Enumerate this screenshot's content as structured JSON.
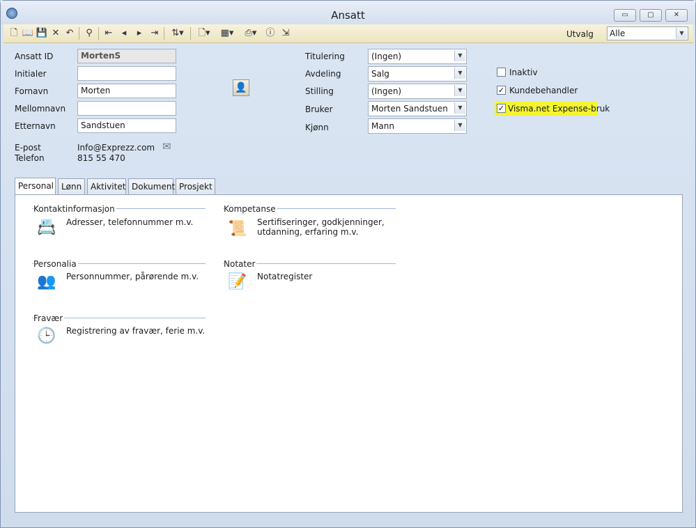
{
  "window": {
    "title": "Ansatt",
    "minimize_glyph": "▭",
    "maximize_glyph": "▢",
    "close_glyph": "✕"
  },
  "toolbar": {
    "icons": [
      "new-icon",
      "open-book-icon",
      "save-icon",
      "delete-icon",
      "undo-icon",
      "search-icon",
      "first-record-icon",
      "prev-record-icon",
      "next-record-icon",
      "last-record-icon",
      "sort-icon",
      "document-icon",
      "form-icon",
      "print-icon",
      "help-icon",
      "exit-icon"
    ],
    "utvalg_label": "Utvalg",
    "utvalg_value": "Alle"
  },
  "form": {
    "ansatt_id_label": "Ansatt ID",
    "ansatt_id_value": "MortenS",
    "initialer_label": "Initialer",
    "initialer_value": "",
    "fornavn_label": "Fornavn",
    "fornavn_value": "Morten",
    "mellomnavn_label": "Mellomnavn",
    "mellomnavn_value": "",
    "etternavn_label": "Etternavn",
    "etternavn_value": "Sandstuen",
    "epost_label": "E-post",
    "epost_value": "Info@Exprezz.com",
    "telefon_label": "Telefon",
    "telefon_value": "815 55 470",
    "titulering_label": "Titulering",
    "titulering_value": "(Ingen)",
    "avdeling_label": "Avdeling",
    "avdeling_value": "Salg",
    "stilling_label": "Stilling",
    "stilling_value": "(Ingen)",
    "bruker_label": "Bruker",
    "bruker_value": "Morten Sandstuen",
    "kjonn_label": "Kjønn",
    "kjonn_value": "Mann",
    "inaktiv_label": "Inaktiv",
    "inaktiv_checked": false,
    "kundebehandler_label": "Kundebehandler",
    "kundebehandler_checked": true,
    "expense_label": "Visma.net Expense-bruk",
    "expense_checked": true
  },
  "tabs": [
    {
      "label": "Personal",
      "active": true
    },
    {
      "label": "Lønn",
      "active": false
    },
    {
      "label": "Aktivitet",
      "active": false
    },
    {
      "label": "Dokument",
      "active": false
    },
    {
      "label": "Prosjekt",
      "active": false
    }
  ],
  "groups": {
    "kontakt": {
      "title": "Kontaktinformasjon",
      "link": "Adresser, telefonnummer m.v."
    },
    "kompetanse": {
      "title": "Kompetanse",
      "link1": "Sertifiseringer, godkjenninger,",
      "link2": "utdanning, erfaring m.v."
    },
    "personalia": {
      "title": "Personalia",
      "link": "Personnummer, pårørende m.v."
    },
    "notater": {
      "title": "Notater",
      "link": "Notatregister"
    },
    "fravaer": {
      "title": "Fravær",
      "link": "Registrering av fravær, ferie m.v."
    }
  },
  "colors": {
    "highlight": "#f4f430",
    "toolbar": "#ece5c2",
    "window": "#cfdcec"
  }
}
